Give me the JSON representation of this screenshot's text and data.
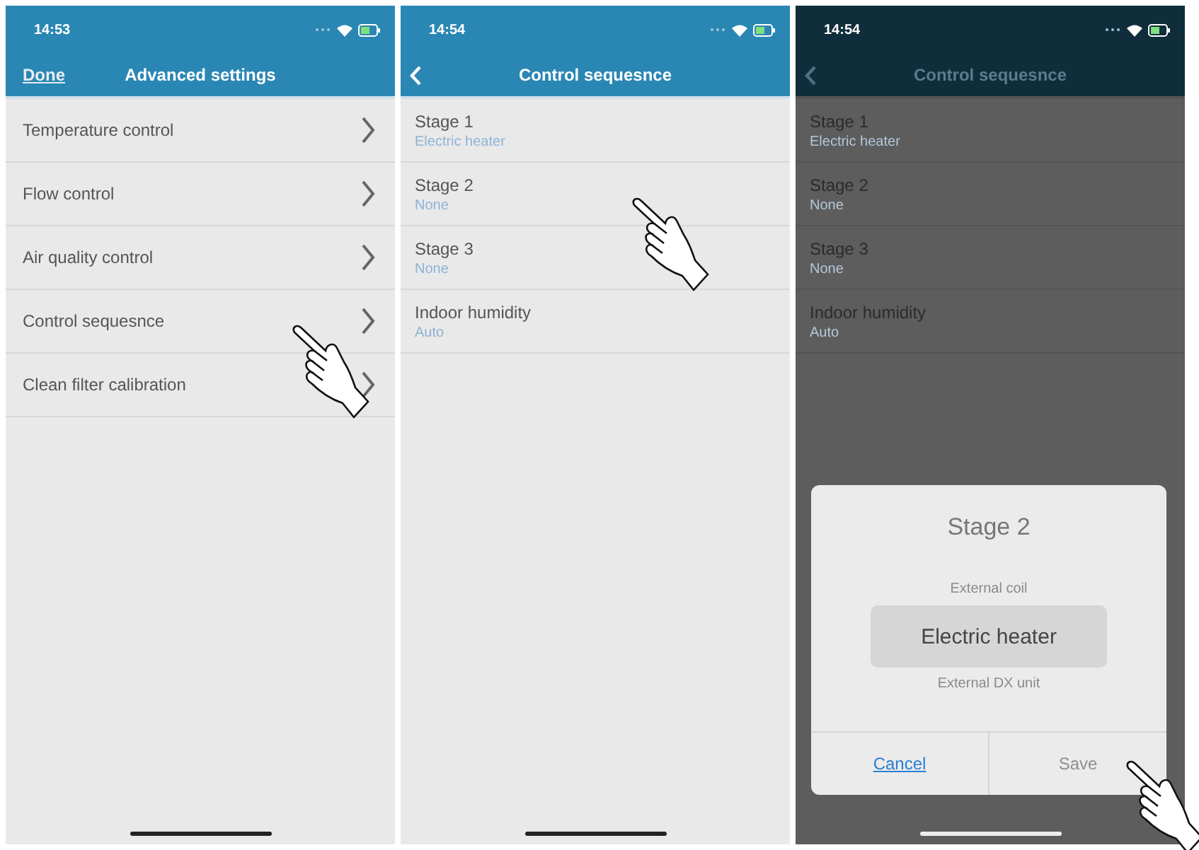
{
  "screens": [
    {
      "kind": "menu",
      "dimmed": false,
      "status": {
        "time": "14:53"
      },
      "nav": {
        "left": "Done",
        "title": "Advanced settings"
      },
      "items": [
        {
          "label": "Temperature control"
        },
        {
          "label": "Flow control"
        },
        {
          "label": "Air quality control"
        },
        {
          "label": "Control sequesnce"
        },
        {
          "label": "Clean filter calibration"
        }
      ]
    },
    {
      "kind": "list",
      "dimmed": false,
      "status": {
        "time": "14:54"
      },
      "nav": {
        "back": true,
        "title": "Control sequesnce"
      },
      "items": [
        {
          "label": "Stage 1",
          "value": "Electric heater"
        },
        {
          "label": "Stage 2",
          "value": "None"
        },
        {
          "label": "Stage 3",
          "value": "None"
        },
        {
          "label": "Indoor humidity",
          "value": "Auto"
        }
      ]
    },
    {
      "kind": "list",
      "dimmed": true,
      "status": {
        "time": "14:54"
      },
      "nav": {
        "back": true,
        "title": "Control sequesnce"
      },
      "items": [
        {
          "label": "Stage 1",
          "value": "Electric heater"
        },
        {
          "label": "Stage 2",
          "value": "None"
        },
        {
          "label": "Stage 3",
          "value": "None"
        },
        {
          "label": "Indoor humidity",
          "value": "Auto"
        }
      ],
      "dialog": {
        "title": "Stage 2",
        "options": [
          {
            "label": "External coil",
            "selected": false
          },
          {
            "label": "Electric heater",
            "selected": true
          },
          {
            "label": "External DX unit",
            "selected": false
          }
        ],
        "buttons": [
          {
            "label": "Cancel",
            "kind": "cancel",
            "disabled": false
          },
          {
            "label": "Save",
            "kind": "save",
            "disabled": true
          }
        ]
      }
    }
  ]
}
